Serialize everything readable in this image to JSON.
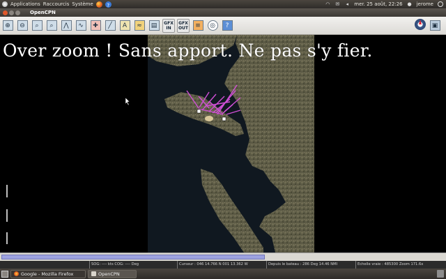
{
  "top_panel": {
    "menus": [
      "Applications",
      "Raccourcis",
      "Système"
    ],
    "clock": "mer. 25 août, 22:26",
    "user": "jerome"
  },
  "window": {
    "title": "OpenCPN"
  },
  "toolbar": {
    "buttons": [
      "zoom-in",
      "zoom-out",
      "scale-in",
      "scale-out",
      "route",
      "man-overboard",
      "measure",
      "text",
      "chart-tide",
      "print",
      "gfx-in",
      "gfx-out",
      "layers",
      "help"
    ],
    "gfx_in_label": "GFX\nIN",
    "gfx_out_label": "GFX\nOUT"
  },
  "chart": {
    "overzoom_message": "Over zoom !  Sans apport. Ne pas s'y fier."
  },
  "status_bar": {
    "progress_fraction": 0.595,
    "sog_cog": "SOG: ---- kts  COG: ---- Deg",
    "cursor": "Curseur : 046 14.766 N 001 13.362 W",
    "from_boat": "Depuis le bateau : 286 Deg     14.46 NMI",
    "scale": "Echelle vraie :    485300   Zoom 171.6x"
  },
  "taskbar": {
    "tasks": [
      {
        "label": "Google - Mozilla Firefox",
        "active": false
      },
      {
        "label": "OpenCPN",
        "active": true
      }
    ]
  },
  "colors": {
    "accent": "#9da2e0",
    "track": "#d04fd6",
    "sea": "#121a22"
  }
}
